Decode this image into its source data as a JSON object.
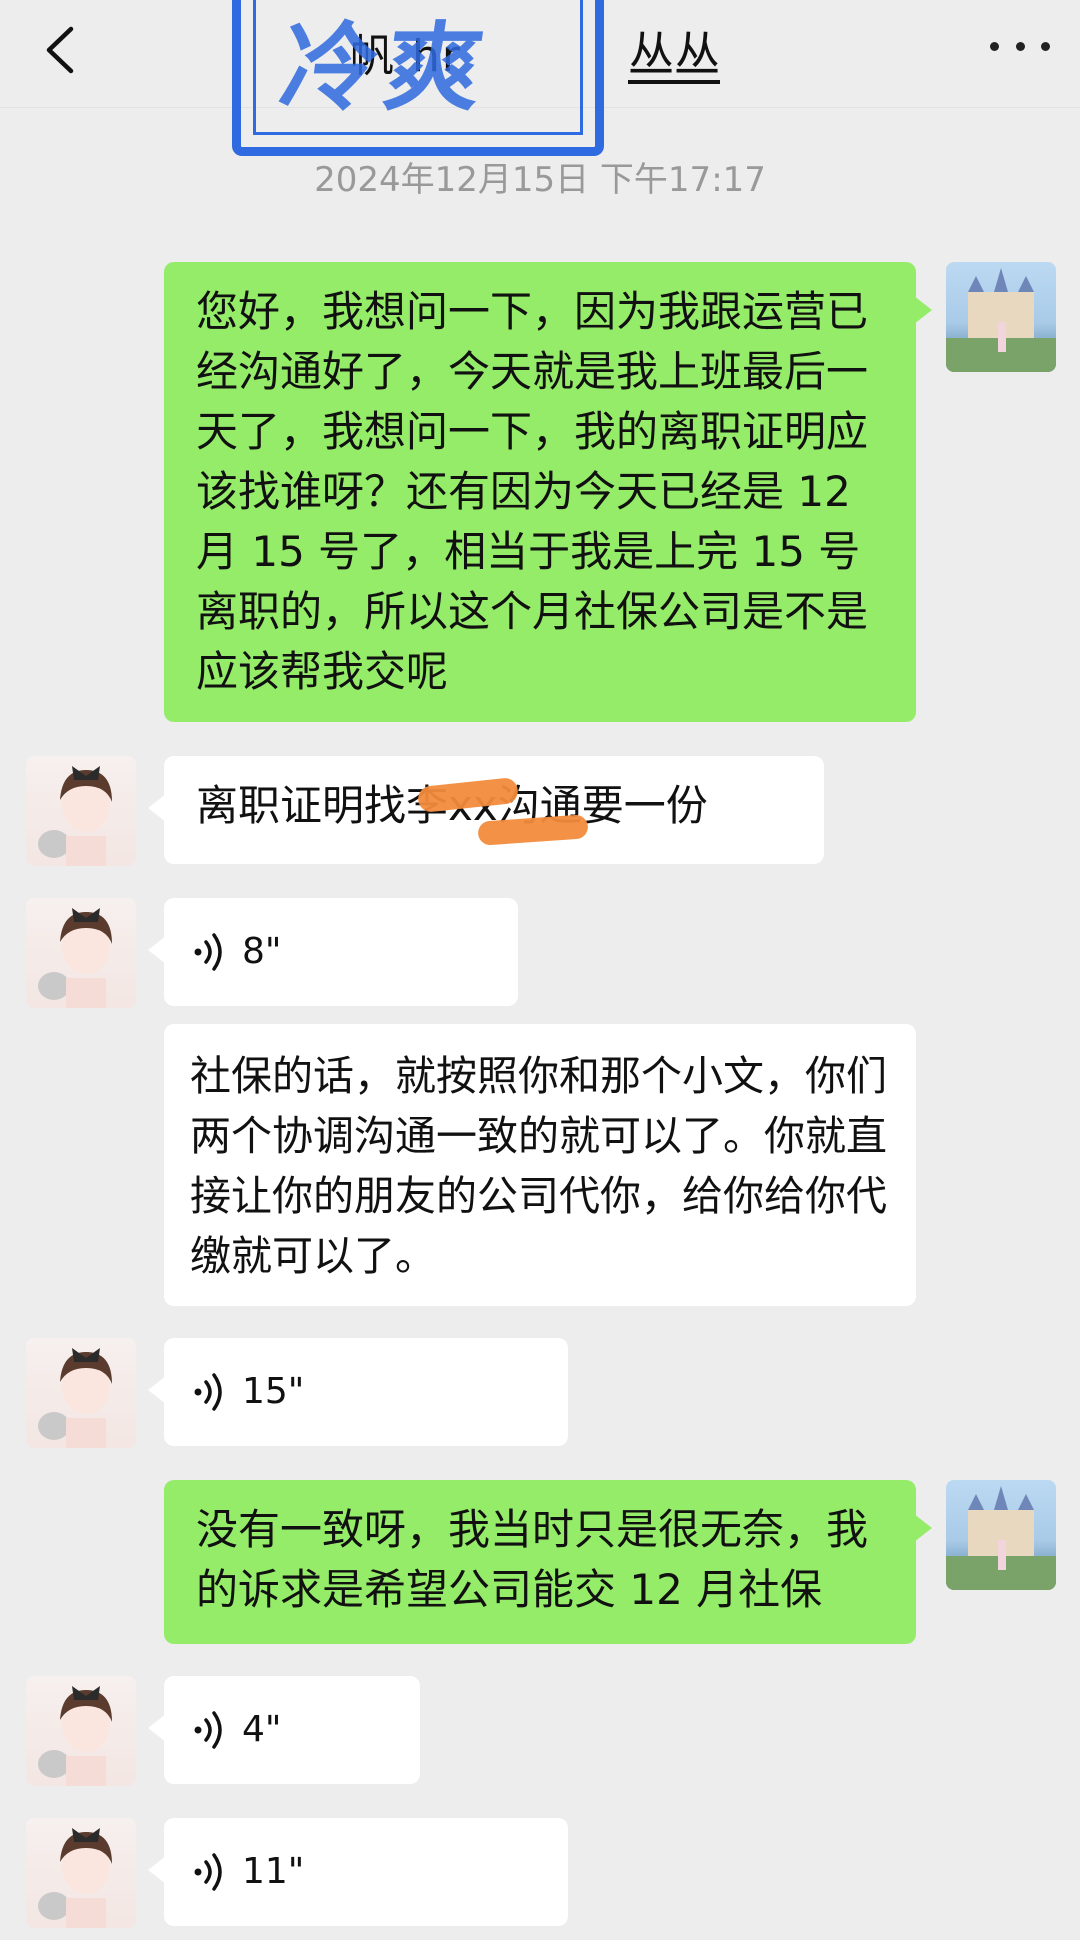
{
  "header": {
    "back_icon": "chevron-left-icon",
    "title_partial": "帆 hr",
    "contact_name": "丛丛",
    "more_icon": "more-dots-icon",
    "stamp_text": "冷爽"
  },
  "timestamp": "2024年12月15日 下午17:17",
  "messages": [
    {
      "sender": "me",
      "type": "text",
      "text": "您好，我想问一下，因为我跟运营已经沟通好了，今天就是我上班最后一天了，我想问一下，我的离职证明应该找谁呀？还有因为今天已经是 12 月 15 号了，相当于我是上完 15 号离职的，所以这个月社保公司是不是应该帮我交呢"
    },
    {
      "sender": "other",
      "type": "text",
      "text": "离职证明找李xx沟通要一份"
    },
    {
      "sender": "other",
      "type": "voice",
      "duration": "8\""
    },
    {
      "sender": "other",
      "type": "text",
      "text": "社保的话，就按照你和那个小文，你们两个协调沟通一致的就可以了。你就直接让你的朋友的公司代你，给你给你代缴就可以了。"
    },
    {
      "sender": "other",
      "type": "voice",
      "duration": "15\""
    },
    {
      "sender": "me",
      "type": "text",
      "text": "没有一致呀，我当时只是很无奈，我的诉求是希望公司能交 12 月社保"
    },
    {
      "sender": "other",
      "type": "voice",
      "duration": "4\""
    },
    {
      "sender": "other",
      "type": "voice",
      "duration": "11\""
    }
  ],
  "colors": {
    "my_bubble": "#95ec69",
    "their_bubble": "#ffffff",
    "background": "#ededed",
    "stamp": "#2f6ae0",
    "redaction": "#f28b3c"
  }
}
